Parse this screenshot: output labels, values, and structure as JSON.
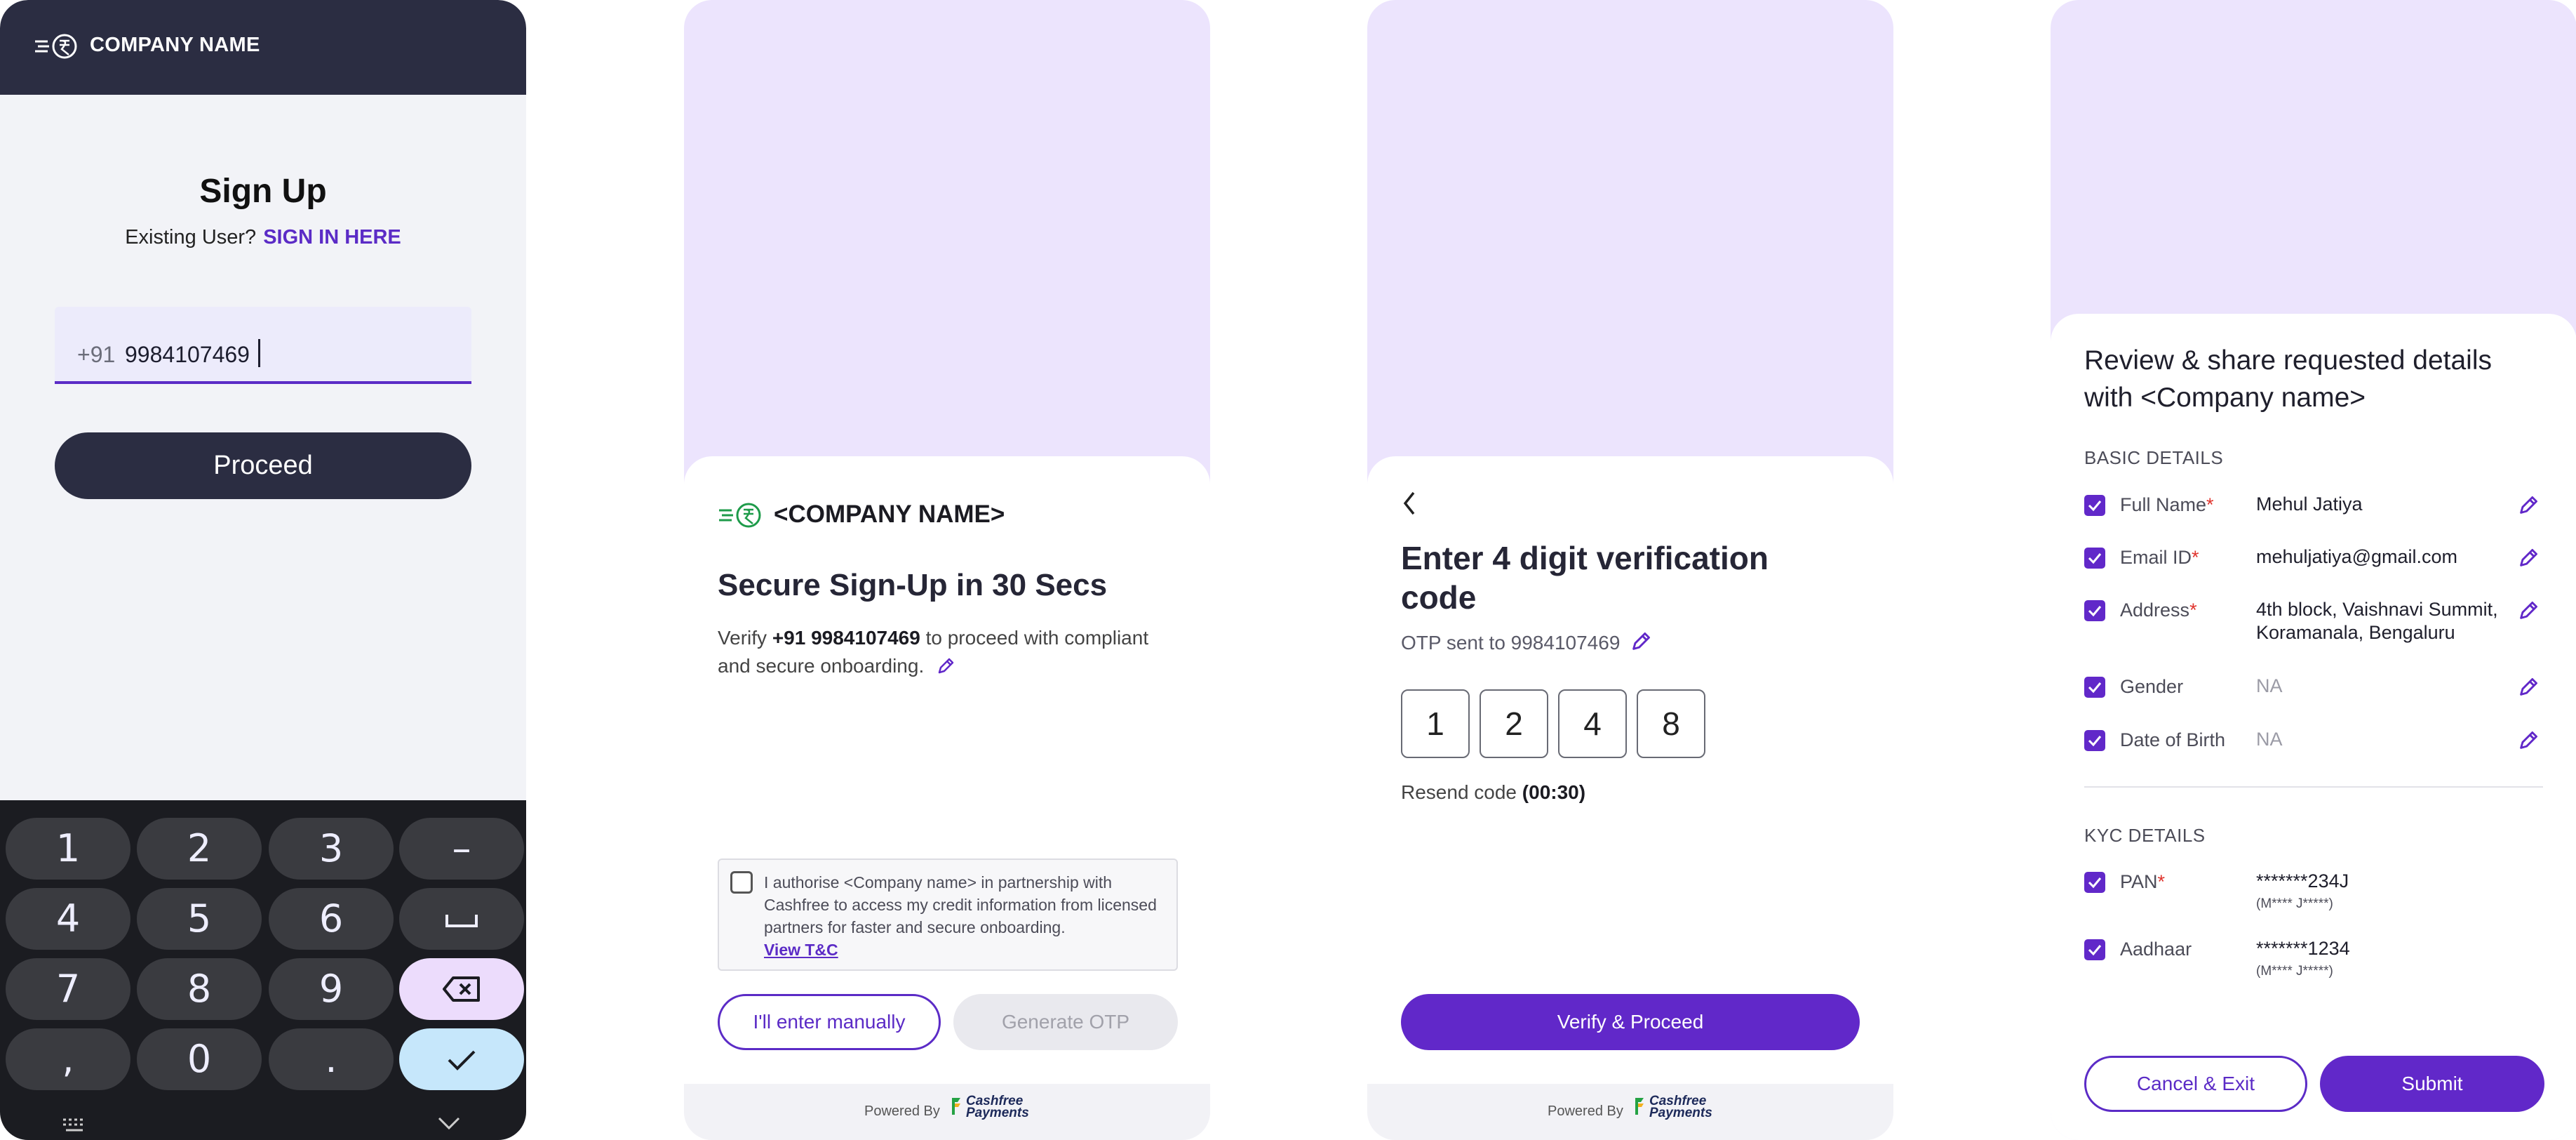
{
  "screen1": {
    "header_company": "COMPANY NAME",
    "title": "Sign Up",
    "existing_prompt": "Existing User?",
    "sign_in_link": "SIGN IN HERE",
    "phone_prefix": "+91",
    "phone_value": "9984107469",
    "proceed_label": "Proceed",
    "keyboard": {
      "row1": [
        "1",
        "2",
        "3",
        "–"
      ],
      "row2": [
        "4",
        "5",
        "6",
        "␣"
      ],
      "row3": [
        "7",
        "8",
        "9"
      ],
      "row4": [
        ",",
        "0",
        "."
      ]
    }
  },
  "screen2": {
    "company": "<COMPANY NAME>",
    "title": "Secure Sign-Up in 30 Secs",
    "desc_prefix": "Verify",
    "desc_phone": "+91 9984107469",
    "desc_suffix": "to proceed with compliant and secure onboarding.",
    "consent_text": "I authorise <Company name> in partnership with Cashfree to access my credit information from licensed partners for faster and secure onboarding.",
    "view_tc": "View T&C",
    "manual_button": "I'll enter manually",
    "generate_otp_button": "Generate OTP",
    "powered_by": "Powered By",
    "cashfree_line1": "Cashfree",
    "cashfree_line2": "Payments"
  },
  "screen3": {
    "title": "Enter 4 digit verification code",
    "otp_sent": "OTP sent to 9984107469",
    "otp_digits": [
      "1",
      "2",
      "4",
      "8"
    ],
    "resend_label": "Resend code",
    "resend_timer": "(00:30)",
    "verify_button": "Verify & Proceed",
    "powered_by": "Powered By",
    "cashfree_line1": "Cashfree",
    "cashfree_line2": "Payments"
  },
  "screen4": {
    "title": "Review & share requested details with <Company name>",
    "basic_section": "BASIC DETAILS",
    "full_name_label": "Full Name",
    "full_name_value": "Mehul Jatiya",
    "email_label": "Email ID",
    "email_value": "mehuljatiya@gmail.com",
    "address_label": "Address",
    "address_value": "4th block, Vaishnavi Summit, Koramanala, Bengaluru",
    "gender_label": "Gender",
    "gender_value": "NA",
    "dob_label": "Date of Birth",
    "dob_value": "NA",
    "kyc_section": "KYC DETAILS",
    "pan_label": "PAN",
    "pan_value": "*******234J",
    "pan_sub": "(M**** J*****)",
    "aadhaar_label": "Aadhaar",
    "aadhaar_value": "*******1234",
    "aadhaar_sub": "(M**** J*****)",
    "required_mark": "*",
    "cancel_button": "Cancel & Exit",
    "submit_button": "Submit"
  },
  "colors": {
    "accent": "#6128c9",
    "header_dark": "#2b2d42",
    "lavender": "#ece4fd",
    "required": "#e0342d"
  }
}
